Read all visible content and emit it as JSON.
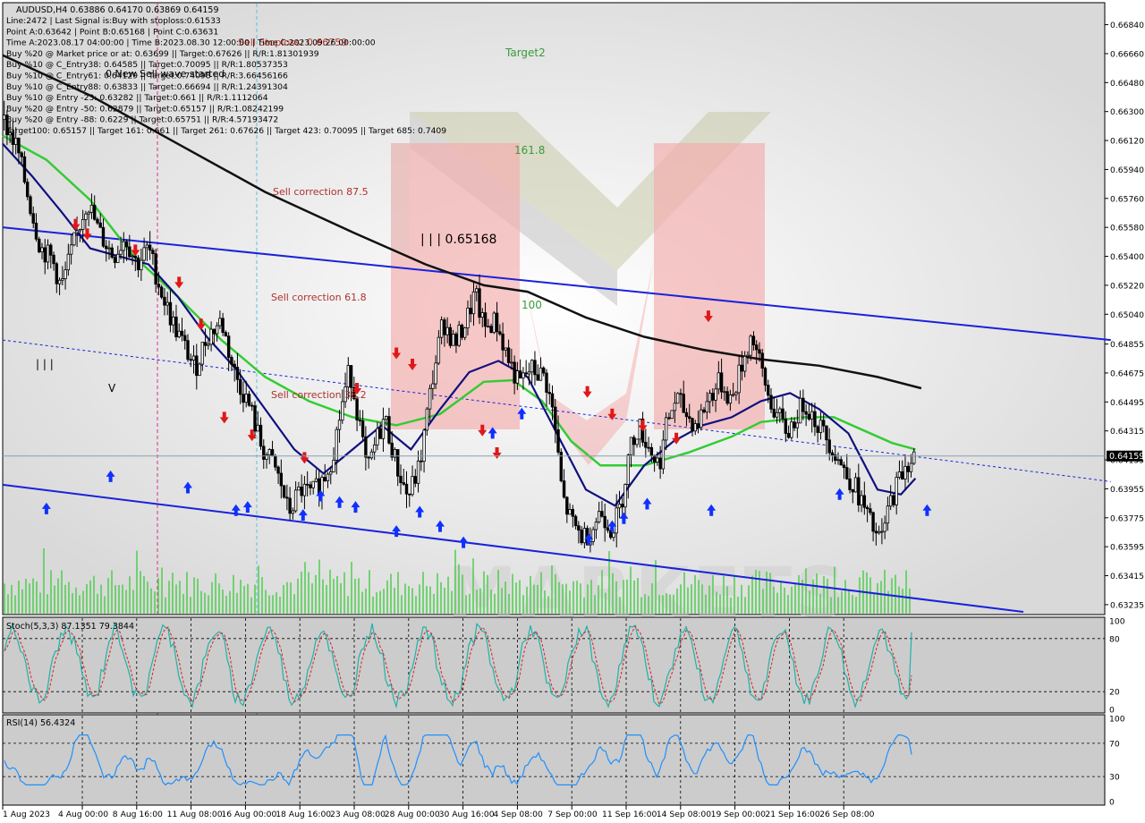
{
  "chart_data": {
    "type": "candlestick",
    "symbol_line": "AUDUSD,H4  0.63886 0.64170 0.63869 0.64159",
    "info_lines": [
      "Line:2472 | Last Signal is:Buy with stoploss:0.61533",
      "Point A:0.63642 | Point B:0.65168 | Point C:0.63631",
      "Time A:2023.08.17 04:00:00 | Time B:2023.08.30 12:00:00 | Time C:2023.09.26 00:00:00",
      "Buy %20 @ Market price or at: 0.63699 || Target:0.67626 || R/R:1.81301939",
      "Buy %10 @ C_Entry38: 0.64585 || Target:0.70095 || R/R:1.80537353",
      "Buy %10 @ C_Entry61: 0.64129 || Target:0.74098 || R/R:3.66456166",
      "Buy %10 @ C_Entry88: 0.63833 || Target:0.66694 || R/R:1.24391304",
      "Buy %10 @ Entry -23: 0.63282 || Target:0.661 || R/R:1.1112064",
      "Buy %20 @ Entry -50: 0.62879 || Target:0.65157 || R/R:1.08242199",
      "Buy %20 @ Entry -88: 0.6229 || Target:0.65751 || R/R:4.57193472",
      "Target100: 0.65157 || Target 161: 0.661 || Target 261: 0.67626 || Target 423: 0.70095 || Target 685: 0.7409"
    ],
    "overlay_red_text": "Sell Stoploss: 0.66759",
    "overlay_black_text": "0 New Sell wave started",
    "annotations": {
      "target2": "Target2",
      "fib_161": "161.8",
      "fib_100": "100",
      "sell_875": "Sell correction 87.5",
      "sell_618": "Sell correction 61.8",
      "sell_382": "Sell correction 38.2",
      "wave_label": "| | | 0.65168",
      "wave_a": "| | |",
      "wave_v": "V"
    },
    "price_ticks": [
      "0.66840",
      "0.66660",
      "0.66480",
      "0.66300",
      "0.66120",
      "0.65940",
      "0.65760",
      "0.65580",
      "0.65400",
      "0.65220",
      "0.65040",
      "0.64855",
      "0.64675",
      "0.64495",
      "0.64315",
      "0.64135",
      "0.63955",
      "0.63775",
      "0.63595",
      "0.63415",
      "0.63235"
    ],
    "price_range": [
      0.6319,
      0.6696
    ],
    "current_price": "0.64159",
    "current_price_value": 0.64159,
    "time_labels": [
      "1 Aug 2023",
      "4 Aug 00:00",
      "8 Aug 16:00",
      "11 Aug 08:00",
      "16 Aug 00:00",
      "18 Aug 16:00",
      "23 Aug 08:00",
      "28 Aug 00:00",
      "30 Aug 16:00",
      "4 Sep 08:00",
      "7 Sep 00:00",
      "11 Sep 16:00",
      "14 Sep 08:00",
      "19 Sep 00:00",
      "21 Sep 16:00",
      "26 Sep 08:00"
    ],
    "close_path": [
      [
        0,
        0.6625
      ],
      [
        10,
        0.6607
      ],
      [
        18,
        0.6575
      ],
      [
        26,
        0.6545
      ],
      [
        34,
        0.6538
      ],
      [
        40,
        0.652
      ],
      [
        48,
        0.6545
      ],
      [
        58,
        0.6575
      ],
      [
        66,
        0.6555
      ],
      [
        76,
        0.654
      ],
      [
        84,
        0.6552
      ],
      [
        92,
        0.6535
      ],
      [
        100,
        0.6545
      ],
      [
        108,
        0.652
      ],
      [
        116,
        0.65
      ],
      [
        124,
        0.6485
      ],
      [
        132,
        0.647
      ],
      [
        140,
        0.649
      ],
      [
        150,
        0.65
      ],
      [
        158,
        0.647
      ],
      [
        170,
        0.6445
      ],
      [
        178,
        0.642
      ],
      [
        186,
        0.641
      ],
      [
        192,
        0.6395
      ],
      [
        196,
        0.638
      ],
      [
        204,
        0.6395
      ],
      [
        212,
        0.6392
      ],
      [
        220,
        0.6402
      ],
      [
        226,
        0.6415
      ],
      [
        232,
        0.6445
      ],
      [
        238,
        0.647
      ],
      [
        244,
        0.644
      ],
      [
        250,
        0.6405
      ],
      [
        256,
        0.6425
      ],
      [
        262,
        0.644
      ],
      [
        270,
        0.641
      ],
      [
        278,
        0.639
      ],
      [
        286,
        0.641
      ],
      [
        294,
        0.646
      ],
      [
        302,
        0.65
      ],
      [
        310,
        0.6485
      ],
      [
        318,
        0.65
      ],
      [
        324,
        0.6517
      ],
      [
        330,
        0.6495
      ],
      [
        338,
        0.65
      ],
      [
        346,
        0.6478
      ],
      [
        354,
        0.646
      ],
      [
        362,
        0.647
      ],
      [
        372,
        0.6465
      ],
      [
        378,
        0.644
      ],
      [
        384,
        0.639
      ],
      [
        390,
        0.6375
      ],
      [
        398,
        0.6365
      ],
      [
        404,
        0.637
      ],
      [
        410,
        0.6382
      ],
      [
        418,
        0.637
      ],
      [
        424,
        0.6385
      ],
      [
        430,
        0.642
      ],
      [
        436,
        0.6435
      ],
      [
        444,
        0.642
      ],
      [
        450,
        0.641
      ],
      [
        456,
        0.6438
      ],
      [
        462,
        0.6452
      ],
      [
        470,
        0.644
      ],
      [
        476,
        0.6435
      ],
      [
        484,
        0.6452
      ],
      [
        492,
        0.6462
      ],
      [
        500,
        0.645
      ],
      [
        506,
        0.647
      ],
      [
        514,
        0.6492
      ],
      [
        520,
        0.647
      ],
      [
        526,
        0.645
      ],
      [
        532,
        0.644
      ],
      [
        538,
        0.643
      ],
      [
        544,
        0.644
      ],
      [
        550,
        0.645
      ],
      [
        556,
        0.644
      ],
      [
        562,
        0.6432
      ],
      [
        570,
        0.642
      ],
      [
        578,
        0.6405
      ],
      [
        584,
        0.6398
      ],
      [
        590,
        0.6385
      ],
      [
        596,
        0.6372
      ],
      [
        602,
        0.6362
      ],
      [
        608,
        0.6385
      ],
      [
        614,
        0.64
      ],
      [
        620,
        0.6412
      ],
      [
        626,
        0.6415
      ]
    ],
    "ma_slow": [
      [
        0,
        0.6665
      ],
      [
        60,
        0.664
      ],
      [
        120,
        0.661
      ],
      [
        180,
        0.658
      ],
      [
        240,
        0.6555
      ],
      [
        290,
        0.6535
      ],
      [
        330,
        0.6522
      ],
      [
        360,
        0.6518
      ],
      [
        400,
        0.6502
      ],
      [
        440,
        0.649
      ],
      [
        480,
        0.6482
      ],
      [
        520,
        0.6476
      ],
      [
        560,
        0.6472
      ],
      [
        600,
        0.6465
      ],
      [
        630,
        0.6458
      ]
    ],
    "ma_green": [
      [
        0,
        0.6615
      ],
      [
        30,
        0.66
      ],
      [
        60,
        0.6575
      ],
      [
        90,
        0.654
      ],
      [
        120,
        0.6515
      ],
      [
        150,
        0.6488
      ],
      [
        180,
        0.6465
      ],
      [
        210,
        0.645
      ],
      [
        240,
        0.644
      ],
      [
        270,
        0.6435
      ],
      [
        300,
        0.6442
      ],
      [
        330,
        0.6462
      ],
      [
        350,
        0.6463
      ],
      [
        370,
        0.645
      ],
      [
        390,
        0.6425
      ],
      [
        410,
        0.641
      ],
      [
        440,
        0.641
      ],
      [
        470,
        0.6418
      ],
      [
        500,
        0.6428
      ],
      [
        520,
        0.6437
      ],
      [
        550,
        0.644
      ],
      [
        570,
        0.644
      ],
      [
        590,
        0.6432
      ],
      [
        610,
        0.6424
      ],
      [
        626,
        0.642
      ]
    ],
    "ma_navy": [
      [
        0,
        0.661
      ],
      [
        20,
        0.659
      ],
      [
        40,
        0.6568
      ],
      [
        60,
        0.6545
      ],
      [
        80,
        0.654
      ],
      [
        100,
        0.6535
      ],
      [
        120,
        0.6515
      ],
      [
        140,
        0.649
      ],
      [
        160,
        0.647
      ],
      [
        180,
        0.6445
      ],
      [
        200,
        0.642
      ],
      [
        220,
        0.6405
      ],
      [
        240,
        0.642
      ],
      [
        260,
        0.6435
      ],
      [
        280,
        0.642
      ],
      [
        300,
        0.6445
      ],
      [
        320,
        0.6468
      ],
      [
        340,
        0.6475
      ],
      [
        360,
        0.6465
      ],
      [
        380,
        0.643
      ],
      [
        400,
        0.6395
      ],
      [
        420,
        0.6385
      ],
      [
        440,
        0.641
      ],
      [
        460,
        0.6425
      ],
      [
        480,
        0.6435
      ],
      [
        500,
        0.644
      ],
      [
        520,
        0.645
      ],
      [
        540,
        0.6455
      ],
      [
        560,
        0.6445
      ],
      [
        580,
        0.643
      ],
      [
        600,
        0.6395
      ],
      [
        616,
        0.6392
      ],
      [
        626,
        0.6402
      ]
    ],
    "channel_upper": [
      [
        0,
        0.6558
      ],
      [
        760,
        0.6488
      ]
    ],
    "channel_mid": [
      [
        0,
        0.6488
      ],
      [
        760,
        0.64
      ]
    ],
    "channel_lower": [
      [
        0,
        0.6398
      ],
      [
        700,
        0.6319
      ]
    ],
    "up_arrows": [
      [
        30,
        0.6383
      ],
      [
        74,
        0.6403
      ],
      [
        127,
        0.6396
      ],
      [
        160,
        0.6382
      ],
      [
        168,
        0.6384
      ],
      [
        206,
        0.6379
      ],
      [
        218,
        0.6391
      ],
      [
        231,
        0.6387
      ],
      [
        242,
        0.6384
      ],
      [
        270,
        0.6369
      ],
      [
        286,
        0.6381
      ],
      [
        300,
        0.6372
      ],
      [
        316,
        0.6362
      ],
      [
        336,
        0.643
      ],
      [
        356,
        0.6442
      ],
      [
        402,
        0.6364
      ],
      [
        418,
        0.6372
      ],
      [
        426,
        0.6377
      ],
      [
        442,
        0.6386
      ],
      [
        486,
        0.6382
      ],
      [
        574,
        0.6392
      ],
      [
        634,
        0.6382
      ]
    ],
    "down_arrows": [
      [
        50,
        0.656
      ],
      [
        58,
        0.6554
      ],
      [
        91,
        0.6544
      ],
      [
        121,
        0.6524
      ],
      [
        136,
        0.6498
      ],
      [
        152,
        0.644
      ],
      [
        171,
        0.6429
      ],
      [
        207,
        0.6415
      ],
      [
        243,
        0.6458
      ],
      [
        270,
        0.648
      ],
      [
        281,
        0.6473
      ],
      [
        329,
        0.6432
      ],
      [
        339,
        0.6418
      ],
      [
        401,
        0.6456
      ],
      [
        418,
        0.6442
      ],
      [
        439,
        0.6435
      ],
      [
        462,
        0.6427
      ],
      [
        484,
        0.6503
      ]
    ],
    "stoch_label": "Stoch(5,3,3) 87.1351 79.3844",
    "stoch_ticks": [
      "100",
      "80",
      "20",
      "0"
    ],
    "stoch_range": [
      0,
      100
    ],
    "rsi_label": "RSI(14) 56.4324",
    "rsi_ticks": [
      "100",
      "70",
      "30",
      "0"
    ],
    "rsi_range": [
      0,
      100
    ]
  }
}
